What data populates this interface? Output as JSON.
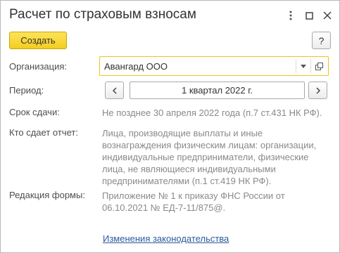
{
  "window": {
    "title": "Расчет по страховым взносам",
    "controls": [
      "more-icon",
      "maximize-icon",
      "close-icon"
    ]
  },
  "toolbar": {
    "create_label": "Создать",
    "help_label": "?"
  },
  "form": {
    "organization": {
      "label": "Организация:",
      "value": "Авангард ООО",
      "icons": [
        "chevron-down-icon",
        "open-link-icon"
      ]
    },
    "period": {
      "label": "Период:",
      "value": "1 квартал 2022 г.",
      "icons": [
        "chevron-left-icon",
        "chevron-right-icon"
      ]
    },
    "deadline": {
      "label": "Срок сдачи:",
      "value": "Не позднее 30 апреля 2022 года (п.7 ст.431 НК РФ)."
    },
    "who_reports": {
      "label": "Кто сдает отчет:",
      "lines": [
        "Лица, производящие выплаты и иные",
        "вознаграждения физическим лицам: организации,",
        "индивидуальные предприниматели, физические",
        "лица, не являющиеся индивидуальными",
        "предпринимателями (п.1 ст.419 НК РФ)."
      ]
    },
    "form_edition": {
      "label": "Редакция формы:",
      "lines": [
        "Приложение № 1 к приказу ФНС России от",
        "06.10.2021 № ЕД-7-11/875@."
      ]
    }
  },
  "footer": {
    "link_label": "Изменения законодательства"
  },
  "colors": {
    "accent_yellow": "#f4cd1d",
    "focus_border": "#f2c21a",
    "link": "#2a5a9c",
    "muted_text": "#8a8a8a"
  }
}
